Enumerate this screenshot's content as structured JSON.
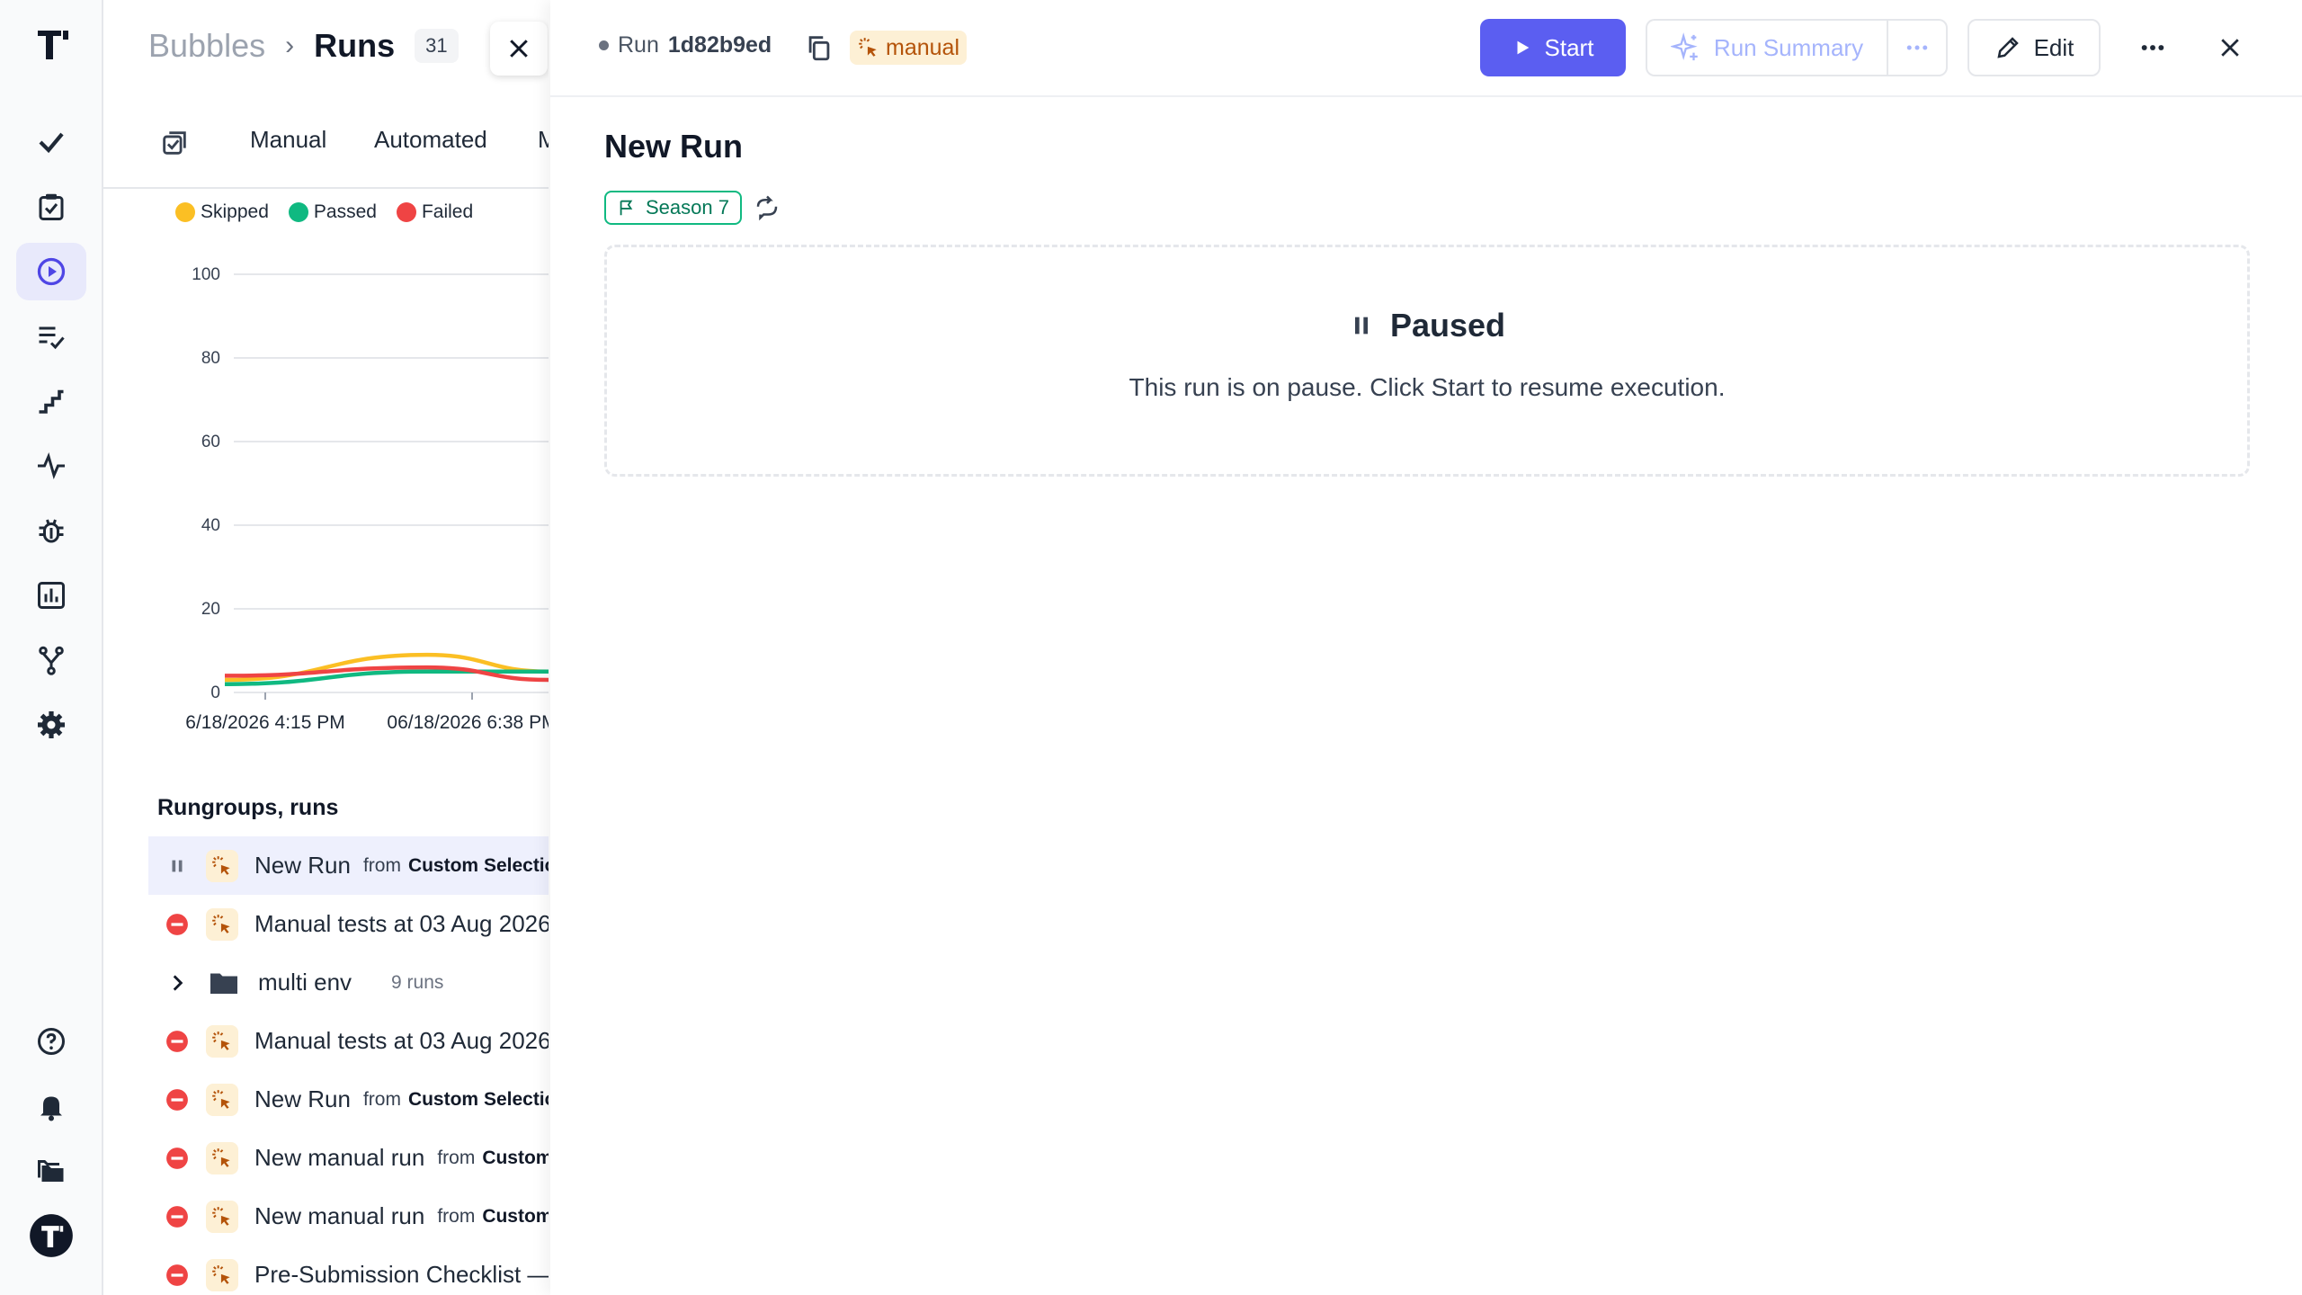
{
  "breadcrumb": {
    "project": "Bubbles",
    "separator": "›",
    "current": "Runs",
    "count": "31"
  },
  "tabs": [
    {
      "label": "Manual"
    },
    {
      "label": "Automated"
    },
    {
      "label": "M"
    }
  ],
  "legend": [
    {
      "label": "Skipped",
      "color": "#fbbf24"
    },
    {
      "label": "Passed",
      "color": "#10b981"
    },
    {
      "label": "Failed",
      "color": "#ef4444"
    }
  ],
  "chart_data": {
    "type": "line",
    "x": [
      "06/18/2026 4:15 PM",
      "06/18/2026 6:38 PM"
    ],
    "x_tick_labels": [
      "6/18/2026 4:15 PM",
      "06/18/2026 6:38 PM"
    ],
    "ylim": [
      0,
      100
    ],
    "yticks": [
      "0",
      "20",
      "40",
      "60",
      "80",
      "100"
    ],
    "series": [
      {
        "name": "Skipped",
        "color": "#fbbf24",
        "values": [
          3,
          9,
          5
        ]
      },
      {
        "name": "Passed",
        "color": "#10b981",
        "values": [
          2,
          5,
          5
        ]
      },
      {
        "name": "Failed",
        "color": "#ef4444",
        "values": [
          4,
          6,
          3
        ]
      }
    ]
  },
  "list": {
    "title": "Rungroups, runs",
    "rows": [
      {
        "status": "paused",
        "name": "New Run",
        "from_label": "from",
        "source": "Custom Selection",
        "selected": true
      },
      {
        "status": "failed",
        "name": "Manual tests at 03 Aug 2026"
      },
      {
        "status": "folder",
        "name": "multi env",
        "meta": "9 runs"
      },
      {
        "status": "failed",
        "name": "Manual tests at 03 Aug 2026"
      },
      {
        "status": "failed",
        "name": "New Run",
        "from_label": "from",
        "source": "Custom Selection"
      },
      {
        "status": "failed",
        "name": "New manual run",
        "from_label": "from",
        "source": "Custom Selection"
      },
      {
        "status": "failed",
        "name": "New manual run",
        "from_label": "from",
        "source": "Custom Selection"
      },
      {
        "status": "failed",
        "name": "Pre-Submission Checklist — QA"
      }
    ]
  },
  "run": {
    "label": "Run",
    "id": "1d82b9ed",
    "type": "manual",
    "title": "New Run",
    "milestone": "Season 7",
    "buttons": {
      "start": "Start",
      "summary": "Run Summary",
      "edit": "Edit"
    },
    "status_title": "Paused",
    "status_text": "This run is on pause. Click Start to resume execution."
  },
  "colors": {
    "accent": "#5b5ef1",
    "manual_bg": "#fdf0d5",
    "manual_text": "#b45309",
    "milestone": "#10b981"
  },
  "icons": {
    "sidebar": [
      "logo-icon",
      "check-icon",
      "clipboard-check-icon",
      "play-circle-icon",
      "list-check-icon",
      "steps-icon",
      "pulse-icon",
      "bug-icon",
      "bar-chart-icon",
      "branch-icon",
      "settings-icon",
      "help-icon",
      "bell-icon",
      "folders-icon",
      "avatar-icon"
    ]
  }
}
